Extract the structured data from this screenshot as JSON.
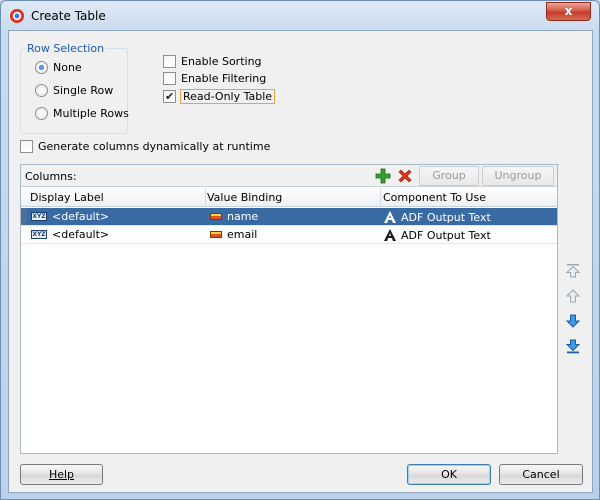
{
  "window": {
    "title": "Create Table",
    "close_label": "x",
    "icon": "oracle-logo-icon"
  },
  "row_selection": {
    "label": "Row Selection",
    "options": [
      {
        "label": "None",
        "checked": true
      },
      {
        "label": "Single Row",
        "checked": false
      },
      {
        "label": "Multiple Rows",
        "checked": false
      }
    ]
  },
  "options": {
    "enable_sorting": {
      "label": "Enable Sorting",
      "checked": false
    },
    "enable_filtering": {
      "label": "Enable Filtering",
      "checked": false
    },
    "read_only": {
      "label": "Read-Only Table",
      "checked": true
    }
  },
  "generate_columns": {
    "label": "Generate columns dynamically at runtime",
    "checked": false
  },
  "columns_panel": {
    "label": "Columns:",
    "add_icon": "add-plus-icon",
    "delete_icon": "delete-x-icon",
    "group_label": "Group",
    "ungroup_label": "Ungroup",
    "headers": [
      "Display Label",
      "Value Binding",
      "Component To Use"
    ],
    "rows": [
      {
        "display_label": "<default>",
        "value_binding": "name",
        "component": "ADF Output Text",
        "selected": true
      },
      {
        "display_label": "<default>",
        "value_binding": "email",
        "component": "ADF Output Text",
        "selected": false
      }
    ]
  },
  "side_buttons": [
    "move-top-icon",
    "move-up-icon",
    "move-down-icon",
    "move-bottom-icon"
  ],
  "buttons": {
    "help": "Help",
    "ok": "OK",
    "cancel": "Cancel"
  },
  "colors": {
    "selection": "#3a6aa4",
    "accent_blue": "#1e5aa8",
    "focus_ring": "#e8a24b"
  }
}
